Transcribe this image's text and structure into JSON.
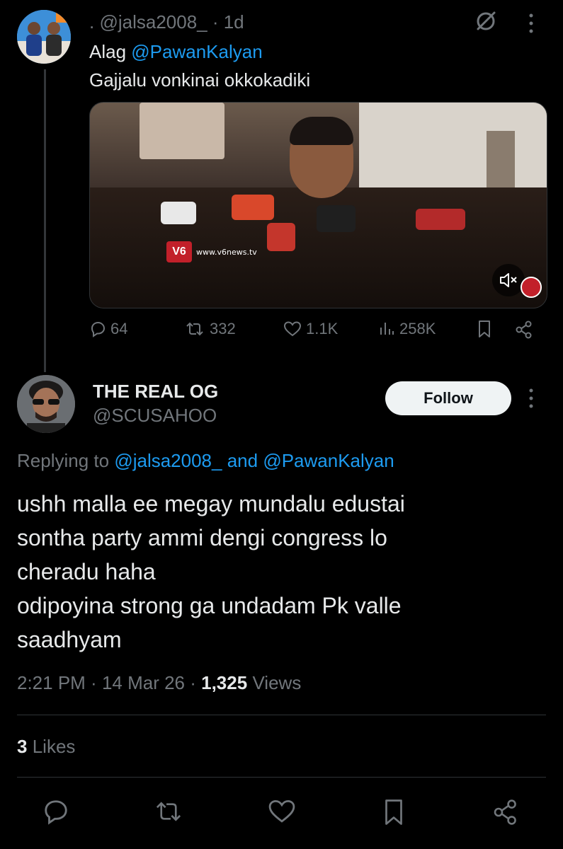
{
  "parent_tweet": {
    "handle_line": ". @jalsa2008_ · 1d",
    "text_prefix": "Alag ",
    "mention": "@PawanKalyan",
    "text_line2": "Gajjalu vonkinai okkokadiki",
    "video": {
      "watermark": "www.v6news.tv",
      "channel_logo": "V6",
      "muted": true
    },
    "stats": {
      "replies": "64",
      "reposts": "332",
      "likes": "1.1K",
      "views": "258K"
    }
  },
  "reply_tweet": {
    "display_name": "THE REAL OG",
    "handle": "@SCUSAHOO",
    "follow_label": "Follow",
    "replying_prefix": "Replying to ",
    "replying_user1": "@jalsa2008_",
    "replying_and": " and ",
    "replying_user2": "@PawanKalyan",
    "body_lines": [
      "ushh malla ee megay mundalu edustai",
      "sontha party ammi dengi congress lo",
      "cheradu haha",
      "odipoyina strong ga undadam Pk valle",
      "saadhyam"
    ],
    "time": "2:21 PM",
    "date": "14 Mar 26",
    "views_count": "1,325",
    "views_label": "Views",
    "likes_count": "3",
    "likes_label": "Likes"
  },
  "colors": {
    "background": "#000000",
    "text": "#e7e9ea",
    "muted": "#71767b",
    "link": "#1d9bf0",
    "divider": "#2f3336"
  }
}
